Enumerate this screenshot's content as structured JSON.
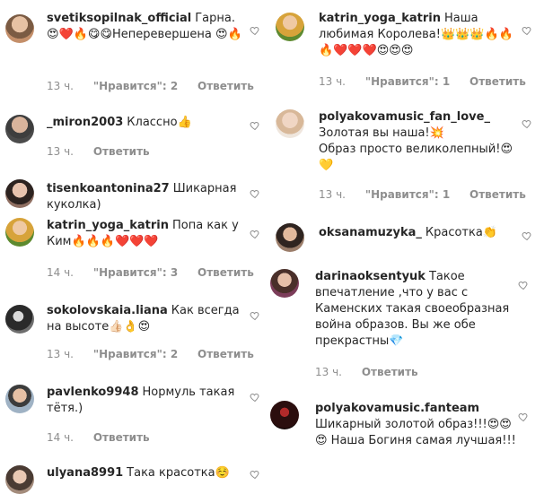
{
  "left_column": [
    {
      "user": "svetiksopilnak_official",
      "text": "Гарна. 😍❤️🔥😋😋Неперевершена 😍🔥",
      "time": "13 ч.",
      "likes": "\"Нравится\": 2",
      "reply": "Ответить"
    },
    {
      "user": "_miron2003",
      "text": "Классно👍",
      "time": "13 ч.",
      "likes": "",
      "reply": "Ответить"
    },
    {
      "user": "tisenkoantonina27",
      "text": "Шикарная куколка)",
      "time": "",
      "likes": "",
      "reply": ""
    },
    {
      "user": "katrin_yoga_katrin",
      "text": "Попа как у Ким🔥🔥🔥❤️❤️❤️",
      "time": "14 ч.",
      "likes": "\"Нравится\": 3",
      "reply": "Ответить"
    },
    {
      "user": "sokolovskaia.liana",
      "text": "Как всегда на высоте👍🏻👌😍",
      "time": "13 ч.",
      "likes": "\"Нравится\": 2",
      "reply": "Ответить"
    },
    {
      "user": "pavlenko9948",
      "text": "Нормуль такая тётя.)",
      "time": "14 ч.",
      "likes": "",
      "reply": "Ответить"
    },
    {
      "user": "ulyana8991",
      "text": "Така красотка☺️",
      "time": "",
      "likes": "",
      "reply": ""
    }
  ],
  "right_column": [
    {
      "user": "katrin_yoga_katrin",
      "text": "Наша любимая Королева!👑👑👑🔥🔥🔥❤️❤️❤️😍😍😍",
      "time": "13 ч.",
      "likes": "\"Нравится\": 1",
      "reply": "Ответить"
    },
    {
      "user": "polyakovamusic_fan_love_",
      "text": "Золотая вы наша!💥\nОбраз просто великолепный!😍💛",
      "time": "13 ч.",
      "likes": "\"Нравится\": 1",
      "reply": "Ответить"
    },
    {
      "user": "oksanamuzyka_",
      "text": "Красотка👏",
      "time": "",
      "likes": "",
      "reply": ""
    },
    {
      "user": "darinaoksentyuk",
      "text": "Такое впечатление ,что у вас с Каменских такая своеобразная война образов. Вы же обе прекрастны💎",
      "time": "13 ч.",
      "likes": "",
      "reply": "Ответить"
    },
    {
      "user": "polyakovamusic.fanteam",
      "text": "Шикарный золотой образ!!!😍😍😍 Наша Богиня самая лучшая!!!",
      "time": "",
      "likes": "",
      "reply": ""
    }
  ],
  "colors": {
    "meta": "#8e8e8e",
    "text": "#262626"
  }
}
